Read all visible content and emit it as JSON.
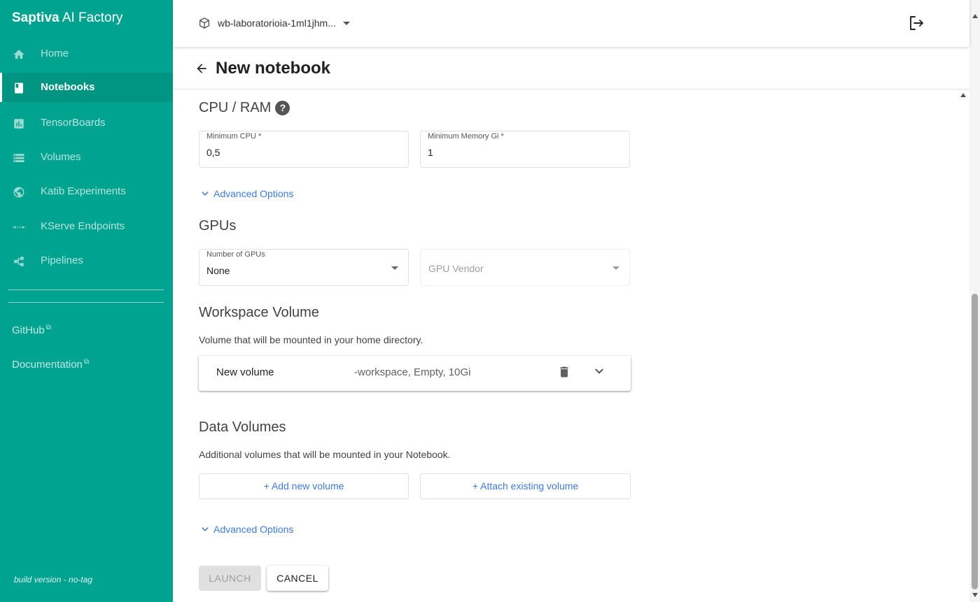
{
  "app": {
    "brand_bold": "Saptiva",
    "brand_rest": " AI Factory"
  },
  "sidebar": {
    "items": [
      {
        "label": "Home",
        "icon": "home-icon"
      },
      {
        "label": "Notebooks",
        "icon": "notebook-icon",
        "active": true
      },
      {
        "label": "TensorBoards",
        "icon": "tensorboard-icon"
      },
      {
        "label": "Volumes",
        "icon": "volumes-icon"
      },
      {
        "label": "Katib Experiments",
        "icon": "katib-icon"
      },
      {
        "label": "KServe Endpoints",
        "icon": "kserve-icon"
      },
      {
        "label": "Pipelines",
        "icon": "pipelines-icon"
      }
    ],
    "links": [
      {
        "label": "GitHub",
        "icon": "external-link-icon"
      },
      {
        "label": "Documentation",
        "icon": "external-link-icon"
      }
    ],
    "build_version": "build version - no-tag"
  },
  "topbar": {
    "namespace": "wb-laboratorioia-1ml1jhm..."
  },
  "page": {
    "title": "New notebook"
  },
  "cpu_ram": {
    "title": "CPU / RAM",
    "help": "?",
    "min_cpu_label": "Minimum CPU *",
    "min_cpu_value": "0,5",
    "min_memory_label": "Minimum Memory Gi *",
    "min_memory_value": "1",
    "advanced_label": "Advanced Options"
  },
  "gpus": {
    "title": "GPUs",
    "number_label": "Number of GPUs",
    "number_value": "None",
    "vendor_placeholder": "GPU Vendor"
  },
  "workspace": {
    "title": "Workspace Volume",
    "description": "Volume that will be mounted in your home directory.",
    "volume_name": "New volume",
    "volume_desc": "-workspace, Empty, 10Gi"
  },
  "data_volumes": {
    "title": "Data Volumes",
    "description": "Additional volumes that will be mounted in your Notebook.",
    "add_new_label": "+ Add new volume",
    "attach_existing_label": "+ Attach existing volume",
    "advanced_label": "Advanced Options"
  },
  "actions": {
    "launch_label": "LAUNCH",
    "cancel_label": "CANCEL"
  },
  "colors": {
    "sidebar_bg": "#00a390",
    "link_blue": "#3f7ad6"
  }
}
